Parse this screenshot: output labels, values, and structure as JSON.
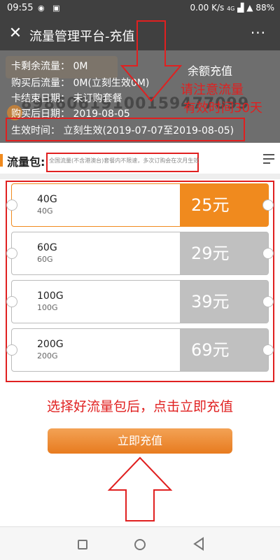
{
  "status_bar": {
    "time": "09:55",
    "speed": "0.00 K/s",
    "network": "4G",
    "battery": "88%"
  },
  "title_bar": {
    "close_glyph": "✕",
    "title": "流量管理平台-充值",
    "more_glyph": "···"
  },
  "info": {
    "remaining": "卡剩余流量：  0M",
    "after_purchase": "购买后流量：  0M(立刻生效0M)",
    "card_end": "卡结束日期：  未订购套餐",
    "purchase_end": "购买后日期：  2019-08-05",
    "effective": "生效时间：  立刻生效(2019-07-07至2019-08-05)",
    "card_number_ghost": "89860619100159477099",
    "balance_label": "余额充值"
  },
  "annotations": {
    "notice_line1": "请注意流量",
    "notice_line2": "有效时间30天",
    "instruction": "选择好流量包后，点击立即充值"
  },
  "flow": {
    "title": "流量包:",
    "note": "全国流量(不含港澳台)套餐内不限速，多次订购会在次月生效"
  },
  "packages": [
    {
      "name": "40G",
      "sub": "40G",
      "price": "25元",
      "selected": true
    },
    {
      "name": "60G",
      "sub": "60G",
      "price": "29元",
      "selected": false
    },
    {
      "name": "100G",
      "sub": "100G",
      "price": "39元",
      "selected": false
    },
    {
      "name": "200G",
      "sub": "200G",
      "price": "69元",
      "selected": false
    }
  ],
  "pay_button": {
    "label": "立即充值"
  },
  "colors": {
    "accent": "#f08a1e",
    "annotation_red": "#e02020",
    "unselected_price": "#c0c0c0"
  },
  "icons": {
    "close": "close-icon",
    "more": "more-icon",
    "menu": "list-menu-icon"
  }
}
